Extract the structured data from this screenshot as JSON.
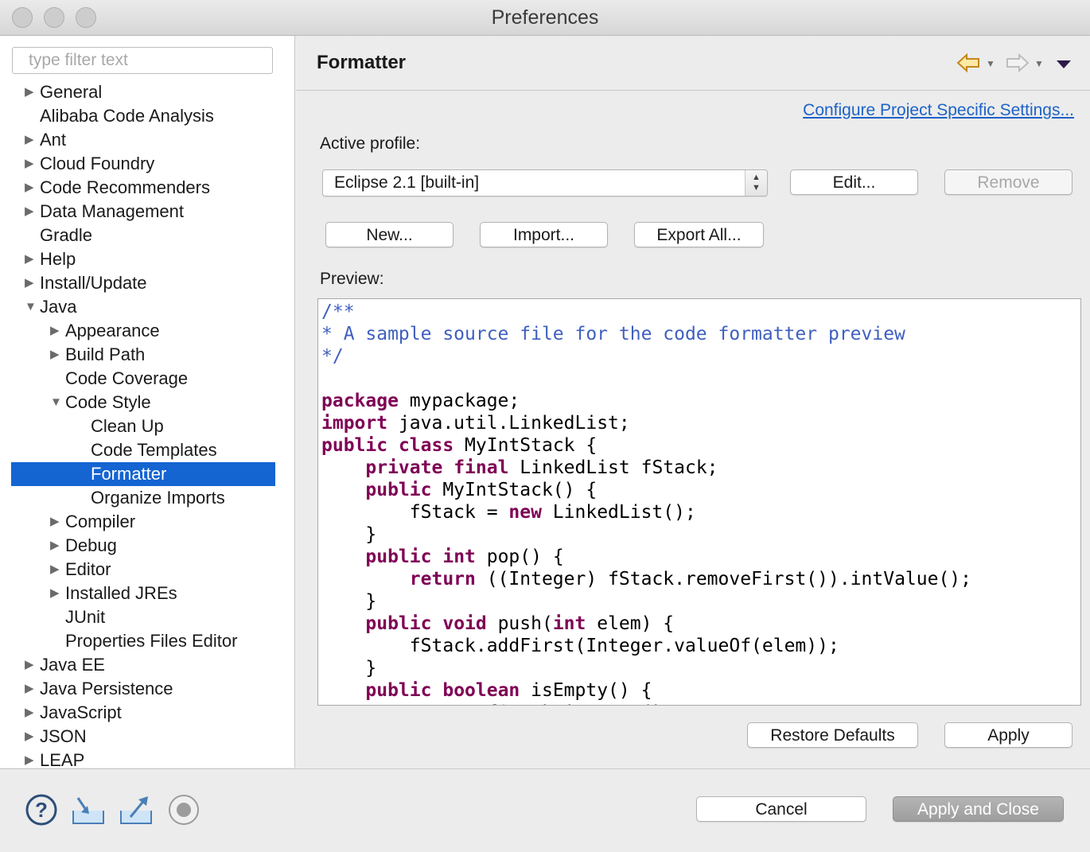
{
  "window": {
    "title": "Preferences"
  },
  "sidebar": {
    "filter_placeholder": "type filter text",
    "items": [
      {
        "label": "General",
        "arrow": "▶"
      },
      {
        "label": "Alibaba Code Analysis",
        "arrow": ""
      },
      {
        "label": "Ant",
        "arrow": "▶"
      },
      {
        "label": "Cloud Foundry",
        "arrow": "▶"
      },
      {
        "label": "Code Recommenders",
        "arrow": "▶"
      },
      {
        "label": "Data Management",
        "arrow": "▶"
      },
      {
        "label": "Gradle",
        "arrow": ""
      },
      {
        "label": "Help",
        "arrow": "▶"
      },
      {
        "label": "Install/Update",
        "arrow": "▶"
      },
      {
        "label": "Java",
        "arrow": "▼"
      },
      {
        "label": "Appearance",
        "arrow": "▶"
      },
      {
        "label": "Build Path",
        "arrow": "▶"
      },
      {
        "label": "Code Coverage",
        "arrow": ""
      },
      {
        "label": "Code Style",
        "arrow": "▼"
      },
      {
        "label": "Clean Up",
        "arrow": ""
      },
      {
        "label": "Code Templates",
        "arrow": ""
      },
      {
        "label": "Formatter",
        "arrow": "",
        "selected": true
      },
      {
        "label": "Organize Imports",
        "arrow": ""
      },
      {
        "label": "Compiler",
        "arrow": "▶"
      },
      {
        "label": "Debug",
        "arrow": "▶"
      },
      {
        "label": "Editor",
        "arrow": "▶"
      },
      {
        "label": "Installed JREs",
        "arrow": "▶"
      },
      {
        "label": "JUnit",
        "arrow": ""
      },
      {
        "label": "Properties Files Editor",
        "arrow": ""
      },
      {
        "label": "Java EE",
        "arrow": "▶"
      },
      {
        "label": "Java Persistence",
        "arrow": "▶"
      },
      {
        "label": "JavaScript",
        "arrow": "▶"
      },
      {
        "label": "JSON",
        "arrow": "▶"
      },
      {
        "label": "LEAP",
        "arrow": "▶"
      }
    ]
  },
  "main": {
    "title": "Formatter",
    "project_link": "Configure Project Specific Settings...",
    "active_profile_label": "Active profile:",
    "profile_value": "Eclipse 2.1 [built-in]",
    "edit_label": "Edit...",
    "remove_label": "Remove",
    "new_label": "New...",
    "import_label": "Import...",
    "export_label": "Export All...",
    "preview_label": "Preview:",
    "restore_label": "Restore Defaults",
    "apply_label": "Apply"
  },
  "preview_code": [
    [
      {
        "t": "/**",
        "s": "com"
      }
    ],
    [
      {
        "t": "* A sample source file for the code formatter preview",
        "s": "com"
      }
    ],
    [
      {
        "t": "*/",
        "s": "com"
      }
    ],
    [],
    [
      {
        "t": "package",
        "s": "kw"
      },
      {
        "t": " mypackage;"
      }
    ],
    [
      {
        "t": "import",
        "s": "kw"
      },
      {
        "t": " java.util.LinkedList;"
      }
    ],
    [
      {
        "t": "public",
        "s": "kw"
      },
      {
        "t": " "
      },
      {
        "t": "class",
        "s": "kw"
      },
      {
        "t": " MyIntStack {"
      }
    ],
    [
      {
        "t": "    "
      },
      {
        "t": "private",
        "s": "kw"
      },
      {
        "t": " "
      },
      {
        "t": "final",
        "s": "kw"
      },
      {
        "t": " LinkedList fStack;"
      }
    ],
    [
      {
        "t": "    "
      },
      {
        "t": "public",
        "s": "kw"
      },
      {
        "t": " MyIntStack() {"
      }
    ],
    [
      {
        "t": "        fStack = "
      },
      {
        "t": "new",
        "s": "kw"
      },
      {
        "t": " LinkedList();"
      }
    ],
    [
      {
        "t": "    }"
      }
    ],
    [
      {
        "t": "    "
      },
      {
        "t": "public",
        "s": "kw"
      },
      {
        "t": " "
      },
      {
        "t": "int",
        "s": "kw"
      },
      {
        "t": " pop() {"
      }
    ],
    [
      {
        "t": "        "
      },
      {
        "t": "return",
        "s": "kw"
      },
      {
        "t": " ((Integer) fStack.removeFirst()).intValue();"
      }
    ],
    [
      {
        "t": "    }"
      }
    ],
    [
      {
        "t": "    "
      },
      {
        "t": "public",
        "s": "kw"
      },
      {
        "t": " "
      },
      {
        "t": "void",
        "s": "kw"
      },
      {
        "t": " push("
      },
      {
        "t": "int",
        "s": "kw"
      },
      {
        "t": " elem) {"
      }
    ],
    [
      {
        "t": "        fStack.addFirst(Integer.valueOf(elem));"
      }
    ],
    [
      {
        "t": "    }"
      }
    ],
    [
      {
        "t": "    "
      },
      {
        "t": "public",
        "s": "kw"
      },
      {
        "t": " "
      },
      {
        "t": "boolean",
        "s": "kw"
      },
      {
        "t": " isEmpty() {"
      }
    ],
    [
      {
        "t": "        "
      },
      {
        "t": "return",
        "s": "kw"
      },
      {
        "t": " fStack.isEmpty();"
      }
    ]
  ],
  "footer": {
    "cancel_label": "Cancel",
    "apply_close_label": "Apply and Close"
  },
  "colors": {
    "selection": "#1464d2",
    "link": "#1c63c8",
    "keyword": "#7f0055",
    "comment": "#3f5fbf"
  }
}
